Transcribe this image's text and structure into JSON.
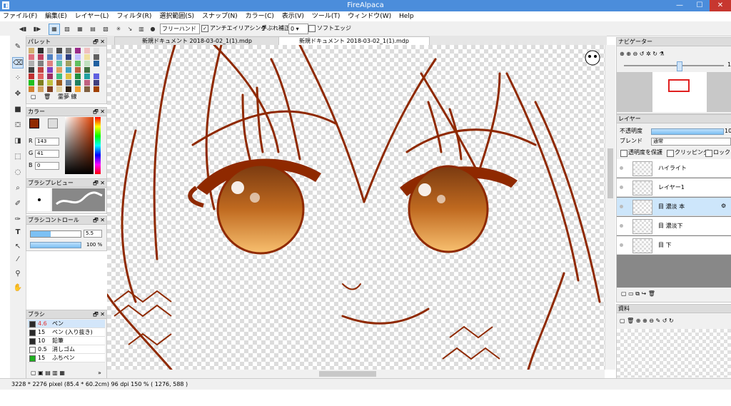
{
  "window": {
    "title": "FireAlpaca",
    "minimize": "—",
    "maximize": "☐",
    "close": "✕"
  },
  "menu": [
    "ファイル(F)",
    "編集(E)",
    "レイヤー(L)",
    "フィルタ(R)",
    "選択範囲(S)",
    "スナップ(N)",
    "カラー(C)",
    "表示(V)",
    "ツール(T)",
    "ウィンドウ(W)",
    "Help"
  ],
  "toolbar": {
    "brush_mode": "フリーハンド ▾",
    "antialias_label": "アンチエイリアシング",
    "antialias_checked": "✓",
    "correction_label": "手ぶれ補正",
    "correction_value": "0 ▾",
    "soft_edge_label": "ソフトエッジ"
  },
  "tabs": [
    "新規ドキュメント 2018-03-02_1(1).mdp",
    "新規ドキュメント 2018-03-02_1(1).mdp"
  ],
  "palette": {
    "title": "パレット",
    "name": "霊夢 線",
    "swatches": [
      "#d0b070",
      "#303030",
      "#b0b0b0",
      "#4a4a4a",
      "#7a7a7a",
      "#9a2b8a",
      "#f0c0c0",
      "#e0e0e0",
      "#e07080",
      "#c04060",
      "#5080c0",
      "#70a0e0",
      "#304080",
      "#c0c0ff",
      "#f0e0a0",
      "#606060",
      "#b0b0b0",
      "#808080",
      "#e08080",
      "#60c0a0",
      "#a0a060",
      "#60c060",
      "#c0e0c0",
      "#2060a0",
      "#404040",
      "#c04040",
      "#8040c0",
      "#e0a060",
      "#40a0c0",
      "#c06040",
      "#407040",
      "#f0f0f0",
      "#c03030",
      "#e06060",
      "#a03060",
      "#40c080",
      "#e0c040",
      "#209040",
      "#20a0a0",
      "#6060e0",
      "#20c020",
      "#808020",
      "#c0c040",
      "#a06020",
      "#6080a0",
      "#208060",
      "#c06080",
      "#404080",
      "#d08030",
      "#d0a060",
      "#804020",
      "#e0d0a0",
      "#302010",
      "#f0a030",
      "#806040",
      "#a04000"
    ]
  },
  "color": {
    "title": "カラー",
    "r_label": "R",
    "g_label": "G",
    "b_label": "B",
    "r": "143",
    "g": "41",
    "b": "0",
    "current": "#8f2900"
  },
  "brush_preview": {
    "title": "ブラシプレビュー"
  },
  "brush_control": {
    "title": "ブラシコントロール",
    "size": "5.5",
    "opacity": "100 %",
    "size_level": 0.4,
    "opacity_level": 1.0
  },
  "brush": {
    "title": "ブラシ",
    "items": [
      {
        "size": "4.6",
        "name": "ペン",
        "color": "#2a2a2a",
        "selected": true
      },
      {
        "size": "15",
        "name": "ペン (入り抜き)",
        "color": "#2a2a2a"
      },
      {
        "size": "10",
        "name": "鉛筆",
        "color": "#2a2a2a"
      },
      {
        "size": "0.5",
        "name": "消しゴム",
        "color": "#ffffff"
      },
      {
        "size": "15",
        "name": "ふちペン",
        "color": "#20b020"
      }
    ]
  },
  "navigator": {
    "title": "ナビゲーター",
    "zoom_value": "1"
  },
  "layer": {
    "title": "レイヤー",
    "opacity_label": "不透明度",
    "opacity_value": "10",
    "opacity_level": 1.0,
    "blend_label": "ブレンド",
    "blend_value": "通常",
    "protect_label": "透明度を保護",
    "clip_label": "クリッピング",
    "lock_label": "ロック",
    "items": [
      "ハイライト",
      "レイヤー1",
      "目 濃淡 本",
      "目 濃淡下",
      "目 下"
    ],
    "selected_index": 2
  },
  "material": {
    "title": "資料"
  },
  "status": {
    "text": "3228 * 2276 pixel   (85.4 * 60.2cm)   96 dpi   150 %   ( 1276, 588 )"
  },
  "panel_buttons": "🗗 ✕"
}
